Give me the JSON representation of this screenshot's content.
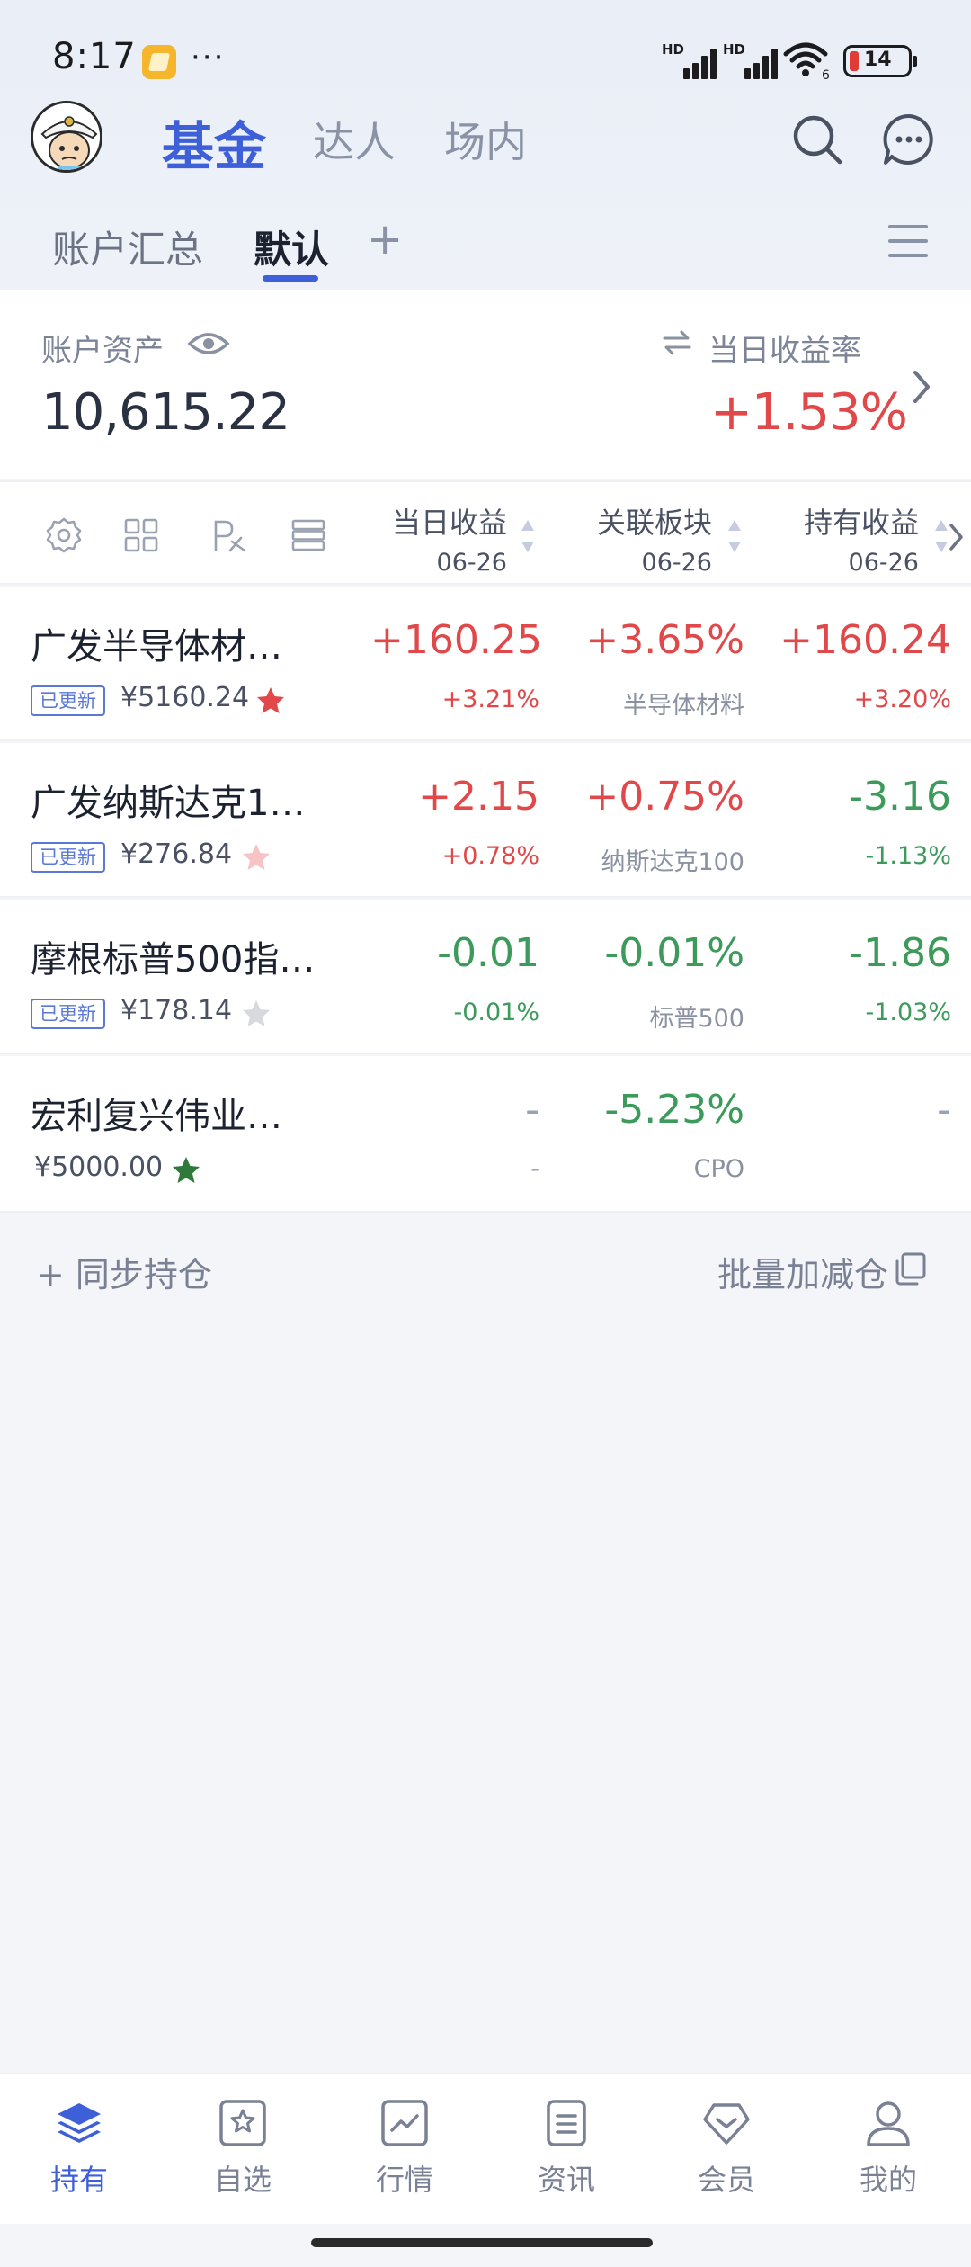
{
  "status_bar": {
    "time": "8:17",
    "dots": "···",
    "signal_1": "HD",
    "signal_2": "HD",
    "wifi_sub": "6",
    "battery_level": "14",
    "battery_color": "#e03b35"
  },
  "header": {
    "tabs": [
      {
        "label": "基金",
        "active": true
      },
      {
        "label": "达人",
        "active": false
      },
      {
        "label": "场内",
        "active": false
      }
    ],
    "accent_color": "#3d5fd8"
  },
  "sub_tabs": {
    "items": [
      {
        "label": "账户汇总",
        "active": false
      },
      {
        "label": "默认",
        "active": true
      }
    ],
    "add": "+"
  },
  "asset": {
    "label": "账户资产",
    "value": "10,615.22",
    "rate_label": "当日收益率",
    "rate_value": "+1.53%"
  },
  "table_header": {
    "columns": [
      {
        "title": "当日收益",
        "date": "06-26"
      },
      {
        "title": "关联板块",
        "date": "06-26"
      },
      {
        "title": "持有收益",
        "date": "06-26"
      }
    ]
  },
  "rows": [
    {
      "name": "广发半导体材…",
      "badge": "已更新",
      "amount": "¥5160.24",
      "star_color": "#e0484a",
      "daily": "+160.25",
      "daily_pct": "+3.21%",
      "sector": "+3.65%",
      "sector_name": "半导体材料",
      "holding": "+160.24",
      "holding_pct": "+3.20%"
    },
    {
      "name": "广发纳斯达克1…",
      "badge": "已更新",
      "amount": "¥276.84",
      "star_color": "#f6c4c4",
      "daily": "+2.15",
      "daily_pct": "+0.78%",
      "sector": "+0.75%",
      "sector_name": "纳斯达克100",
      "holding": "-3.16",
      "holding_pct": "-1.13%"
    },
    {
      "name": "摩根标普500指…",
      "badge": "已更新",
      "amount": "¥178.14",
      "star_color": "#d7d9de",
      "daily": "-0.01",
      "daily_pct": "-0.01%",
      "sector": "-0.01%",
      "sector_name": "标普500",
      "holding": "-1.86",
      "holding_pct": "-1.03%"
    },
    {
      "name": "宏利复兴伟业…",
      "badge": "",
      "amount": "¥5000.00",
      "star_color": "#2f7a3a",
      "daily": "-",
      "daily_pct": "-",
      "sector": "-5.23%",
      "sector_name": "CPO",
      "holding": "-",
      "holding_pct": ""
    }
  ],
  "sync": {
    "left": "+ 同步持仓",
    "right": "批量加减仓"
  },
  "bottom_nav": [
    {
      "label": "持有",
      "icon": "layers-icon",
      "active": true
    },
    {
      "label": "自选",
      "icon": "star-square-icon",
      "active": false
    },
    {
      "label": "行情",
      "icon": "chart-icon",
      "active": false
    },
    {
      "label": "资讯",
      "icon": "document-icon",
      "active": false
    },
    {
      "label": "会员",
      "icon": "diamond-icon",
      "active": false
    },
    {
      "label": "我的",
      "icon": "person-icon",
      "active": false
    }
  ]
}
